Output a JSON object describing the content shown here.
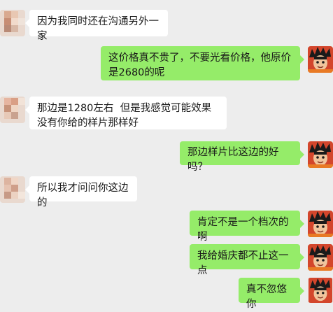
{
  "messages": [
    {
      "side": "left",
      "text": "因为我同时还在沟通另外一家",
      "avatar_icon": "pixelated-avatar-icon"
    },
    {
      "side": "right",
      "text": "这价格真不贵了，不要光看价格，他原价是2680的呢",
      "avatar_icon": "goku-avatar-icon"
    },
    {
      "side": "left",
      "text": "那边是1280左右  但是我感觉可能效果没有你给的样片那样好",
      "avatar_icon": "pixelated-avatar-icon"
    },
    {
      "side": "right",
      "text": "那边样片比这边的好吗？",
      "avatar_icon": "goku-avatar-icon"
    },
    {
      "side": "left",
      "text": "所以我才问问你这边的",
      "avatar_icon": "pixelated-avatar-icon"
    },
    {
      "side": "right",
      "text": "肯定不是一个档次的啊",
      "avatar_icon": "goku-avatar-icon"
    },
    {
      "side": "right",
      "text": "我给婚庆都不止这一点",
      "avatar_icon": "goku-avatar-icon"
    },
    {
      "side": "right",
      "text": "真不忽悠你",
      "avatar_icon": "goku-avatar-icon"
    }
  ],
  "colors": {
    "background": "#ededed",
    "bubble_self": "#95ec69",
    "bubble_other": "#ffffff",
    "text": "#191919"
  }
}
